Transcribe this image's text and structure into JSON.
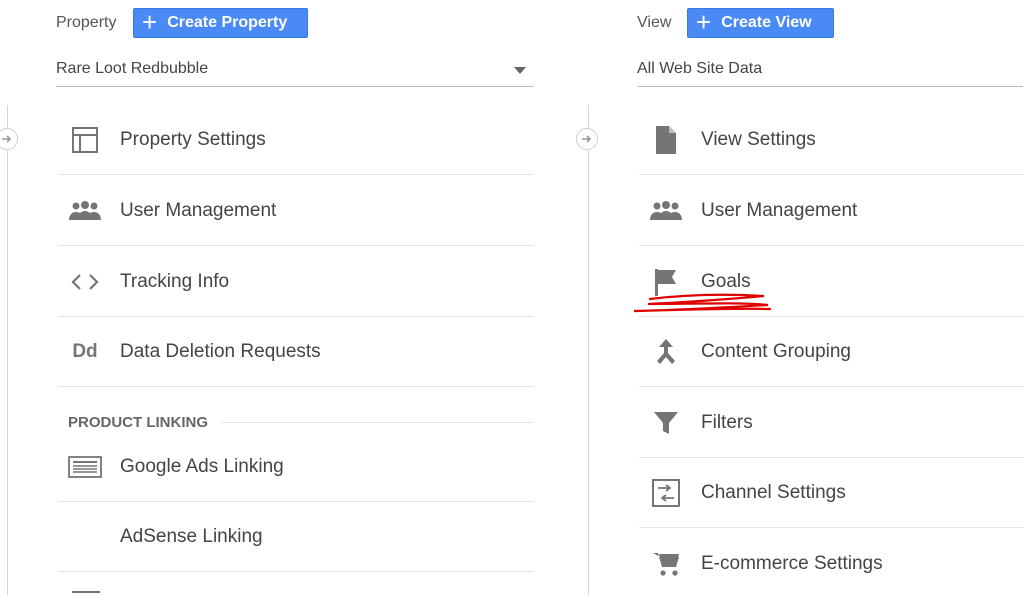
{
  "property_column": {
    "label": "Property",
    "create_button": "Create Property",
    "selected": "Rare Loot Redbubble",
    "items": [
      {
        "label": "Property Settings",
        "icon": "layout-icon"
      },
      {
        "label": "User Management",
        "icon": "people-icon"
      },
      {
        "label": "Tracking Info",
        "icon": "code-icon"
      },
      {
        "label": "Data Deletion Requests",
        "icon": "dd-icon",
        "icon_text": "Dd"
      }
    ],
    "section": "PRODUCT LINKING",
    "linking_items": [
      {
        "label": "Google Ads Linking",
        "icon": "ads-icon"
      },
      {
        "label": "AdSense Linking",
        "icon": ""
      }
    ]
  },
  "view_column": {
    "label": "View",
    "create_button": "Create View",
    "selected": "All Web Site Data",
    "items": [
      {
        "label": "View Settings",
        "icon": "document-icon"
      },
      {
        "label": "User Management",
        "icon": "people-icon"
      },
      {
        "label": "Goals",
        "icon": "flag-icon"
      },
      {
        "label": "Content Grouping",
        "icon": "merge-icon"
      },
      {
        "label": "Filters",
        "icon": "filter-icon"
      },
      {
        "label": "Channel Settings",
        "icon": "channel-icon"
      },
      {
        "label": "E-commerce Settings",
        "icon": "cart-icon"
      }
    ]
  },
  "colors": {
    "button_blue": "#4a8af4",
    "icon_gray": "#757575",
    "annotation_red": "#e00000"
  }
}
